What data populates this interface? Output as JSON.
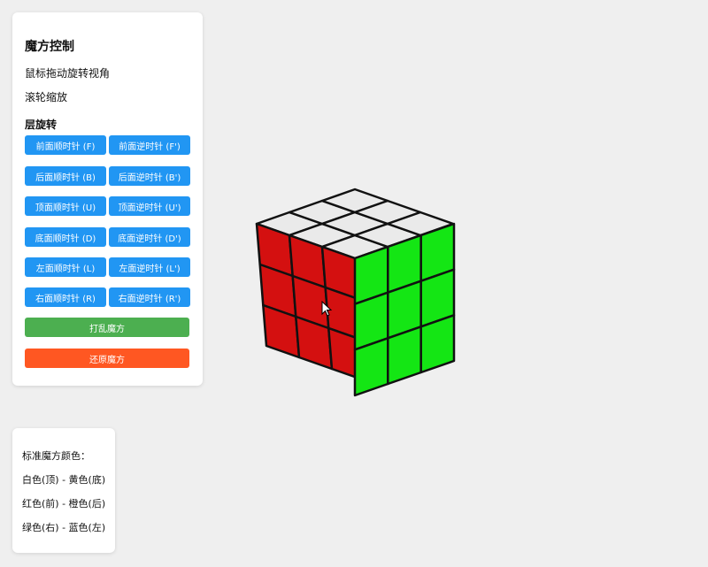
{
  "control_panel": {
    "title": "魔方控制",
    "instruction_drag": "鼠标拖动旋转视角",
    "instruction_zoom": "滚轮缩放",
    "layer_rotation_title": "层旋转",
    "buttons": [
      {
        "label": "前面顺时针 (F)"
      },
      {
        "label": "前面逆时针 (F')"
      },
      {
        "label": "后面顺时针 (B)"
      },
      {
        "label": "后面逆时针 (B')"
      },
      {
        "label": "顶面顺时针 (U)"
      },
      {
        "label": "顶面逆时针 (U')"
      },
      {
        "label": "底面顺时针 (D)"
      },
      {
        "label": "底面逆时针 (D')"
      },
      {
        "label": "左面顺时针 (L)"
      },
      {
        "label": "左面逆时针 (L')"
      },
      {
        "label": "右面顺时针 (R)"
      },
      {
        "label": "右面逆时针 (R')"
      }
    ],
    "scramble_label": "打乱魔方",
    "reset_label": "还原魔方"
  },
  "color_panel": {
    "title": "标准魔方颜色：",
    "lines": [
      "白色(顶) - 黄色(底)",
      "红色(前) - 橙色(后)",
      "绿色(右) - 蓝色(左)"
    ]
  },
  "colors": {
    "button_blue": "#2196f3",
    "scramble_green": "#4caf50",
    "reset_orange": "#ff5722",
    "face_top": "#eaeaea",
    "face_left": "#d41010",
    "face_right": "#14e614"
  },
  "icons": {
    "cursor": "mouse-pointer-icon"
  }
}
